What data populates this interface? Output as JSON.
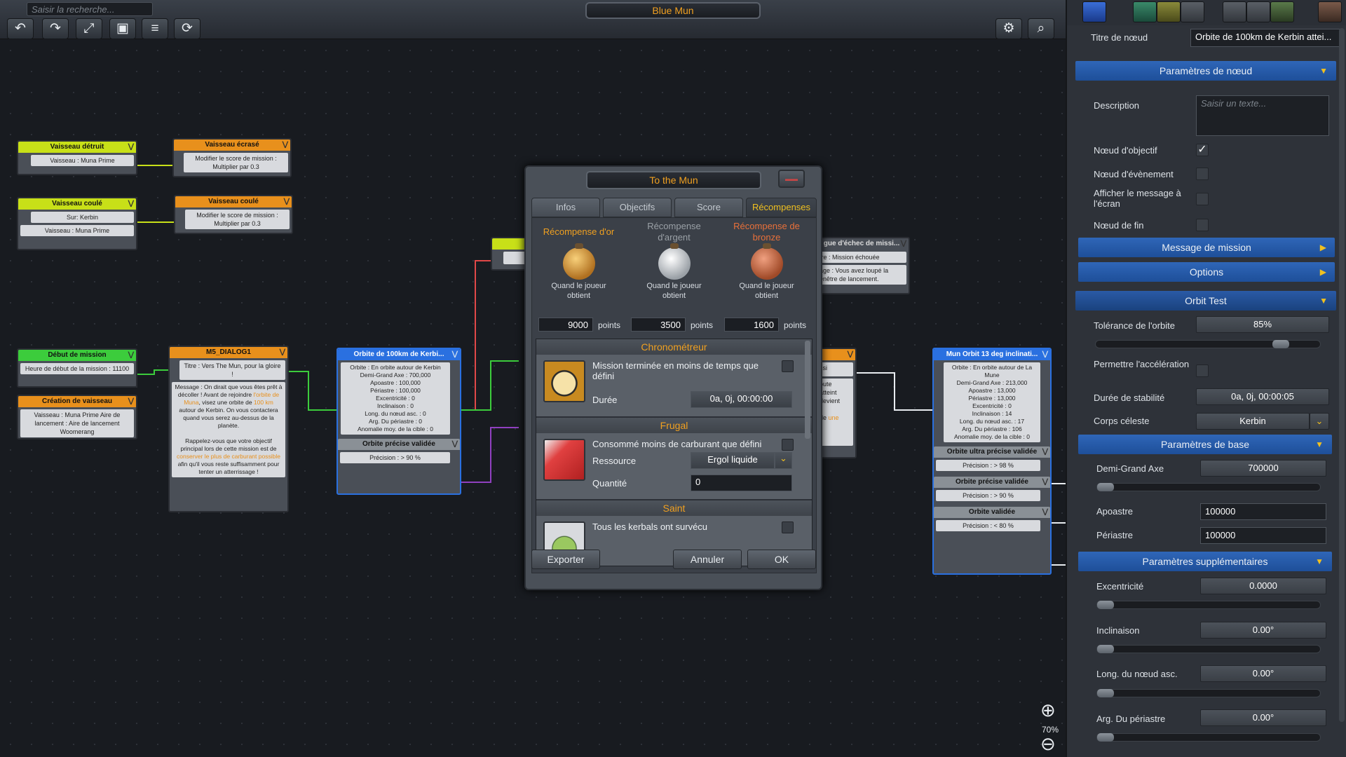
{
  "search": {
    "placeholder": "Saisir la recherche..."
  },
  "mission_title": "Blue Mun",
  "toolbar": {
    "undo": "↶",
    "redo": "↷",
    "expand": "⤢",
    "fit": "▣",
    "layers": "≡",
    "refresh": "⟳",
    "settings": "⚙",
    "zoomfit": "⌕"
  },
  "nodes": {
    "n1": {
      "title": "Vaisseau détruit",
      "body": "Vaisseau : Muna Prime"
    },
    "n2": {
      "title": "Vaisseau écrasé",
      "body": "Modifier le score de mission : Multiplier par 0.3"
    },
    "n3": {
      "title": "Vaisseau coulé",
      "body1": "Sur: Kerbin",
      "body2": "Vaisseau : Muna Prime"
    },
    "n4": {
      "title": "Vaisseau coulé",
      "body": "Modifier le score de mission : Multiplier par 0.3"
    },
    "n5": {
      "title": "Début de mission",
      "body": "Heure de début de la mission : 11100"
    },
    "n6": {
      "title": "Création de vaisseau",
      "body": "Vaisseau : Muna Prime Aire de lancement : Aire de lancement Woomerang"
    },
    "n7": {
      "title": "M5_DIALOG1",
      "subtitle": "Titre : Vers The Mun, pour la gloire !",
      "msg_a": "Message : On dirait que vous êtes prêt à décoller ! Avant de rejoindre",
      "msg_hl1": "l'orbite de Muna",
      "msg_b": ", visez une orbite de",
      "msg_hl2": "100 km",
      "msg_c": "autour de Kerbin. On vous contactera quand vous serez au-dessus de la planète.",
      "msg_d": "Rappelez-vous que votre objectif principal lors de cette mission est de",
      "msg_hl3": "conserver le plus de carburant possible",
      "msg_e": "afin qu'il vous reste suffisamment pour tenter un atterrissage !"
    },
    "n8": {
      "title": "Orbite de 100km de Kerbi...",
      "body": "Orbite : En orbite autour de Kerbin\nDemi-Grand Axe : 700,000\nApoastre : 100,000\nPériastre : 100,000\nExcentricité : 0\nInclinaison : 0\nLong. du nœud asc. : 0\nArg. Du périastre : 0\nAnomalie moy. de la cible : 0",
      "sub_title": "Orbite précise validée",
      "sub_body": "Précision : > 90 %"
    },
    "n9": {
      "title": "gue d'échec de missi...",
      "body1": "tre : Mission échouée",
      "body2": "age : Vous avez loupé la enêtre de lancement."
    },
    "n10": {
      "body_a": "ssi",
      "body_b": "oute atteint devient",
      "body_hl": "une",
      "body_c": "de"
    },
    "n11": {
      "title": "Mun Orbit 13 deg inclinati...",
      "body": "Orbite : En orbite autour de La Mune\nDemi-Grand Axe : 213,000\nApoastre : 13,000\nPériastre : 13,000\nExcentricité : 0\nInclinaison : 14\nLong. du nœud asc. : 17\nArg. Du périastre : 106\nAnomalie moy. de la cible : 0",
      "s1_title": "Orbite ultra précise validée",
      "s1_body": "Précision : > 98 %",
      "s2_title": "Orbite précise validée",
      "s2_body": "Précision : > 90 %",
      "s3_title": "Orbite validée",
      "s3_body": "Précision : < 80 %"
    }
  },
  "dialog": {
    "title": "To the Mun",
    "tabs": [
      "Infos",
      "Objectifs",
      "Score",
      "Récompenses"
    ],
    "rewards": [
      {
        "label": "Récompense d'or",
        "desc": "Quand le joueur obtient",
        "points": "9000",
        "color": "#f0a020"
      },
      {
        "label": "Récompense d'argent",
        "desc": "Quand le joueur obtient",
        "points": "3500",
        "color": "#9aa0a6"
      },
      {
        "label": "Récompense de bronze",
        "desc": "Quand le joueur obtient",
        "points": "1600",
        "color": "#e8703a"
      }
    ],
    "points_label": "points",
    "sections": [
      {
        "title": "Chronométreur",
        "text": "Mission terminée en moins de temps que défini",
        "field_label": "Durée",
        "field_value": "0a, 0j, 00:00:00",
        "icon": "stopwatch-icon"
      },
      {
        "title": "Frugal",
        "text": "Consommé moins de carburant que défini",
        "res_label": "Ressource",
        "res_value": "Ergol liquide",
        "qty_label": "Quantité",
        "qty_value": "0",
        "icon": "fuel-can-icon"
      },
      {
        "title": "Saint",
        "text": "Tous les kerbals ont survécu",
        "icon": "kerbal-halo-icon"
      }
    ],
    "export": "Exporter",
    "cancel": "Annuler",
    "ok": "OK"
  },
  "zoom": {
    "level": "70%",
    "in": "⊕",
    "out": "⊖"
  },
  "panel": {
    "node_title_label": "Titre de nœud",
    "node_title_value": "Orbite de 100km de Kerbin attei...",
    "params_header": "Paramètres de nœud",
    "description_label": "Description",
    "description_placeholder": "Saisir un texte...",
    "objective_label": "Nœud d'objectif",
    "event_label": "Nœud d'évènement",
    "show_msg_label": "Afficher le message à l'écran",
    "end_label": "Nœud de fin",
    "mission_msg": "Message de mission",
    "options": "Options",
    "orbit_test": "Orbit Test",
    "tolerance_label": "Tolérance de l'orbite",
    "tolerance_value": "85%",
    "tolerance_fraction": 0.85,
    "accel_label": "Permettre l'accélération",
    "stability_label": "Durée de stabilité",
    "stability_value": "0a, 0j, 00:00:05",
    "body_label": "Corps céleste",
    "body_value": "Kerbin",
    "base_header": "Paramètres de base",
    "sma_label": "Demi-Grand Axe",
    "sma_value": "700000",
    "apo_label": "Apoastre",
    "apo_value": "100000",
    "peri_label": "Périastre",
    "peri_value": "100000",
    "extra_header": "Paramètres supplémentaires",
    "ecc_label": "Excentricité",
    "ecc_value": "0.0000",
    "inc_label": "Inclinaison",
    "inc_value": "0.00°",
    "lan_label": "Long. du nœud asc.",
    "lan_value": "0.00°",
    "argp_label": "Arg. Du périastre",
    "argp_value": "0.00°"
  },
  "colors": {
    "accent": "#f0a020",
    "panel_blue": "#2a5aa6",
    "node_green": "#3ccc3c",
    "node_yellow": "#c8e018",
    "node_orange": "#e8901c",
    "node_blue": "#2a70e0"
  }
}
